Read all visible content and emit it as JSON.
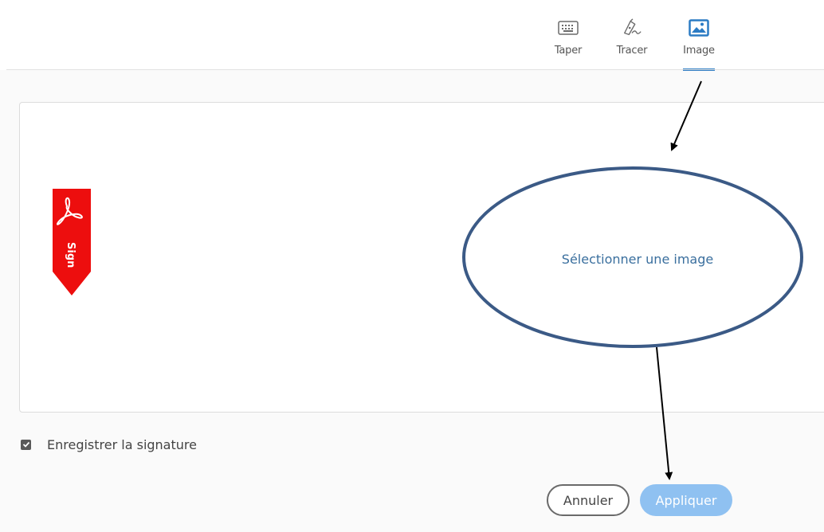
{
  "tabs": [
    {
      "label": "Taper",
      "icon": "keyboard-icon"
    },
    {
      "label": "Tracer",
      "icon": "pen-draw-icon"
    },
    {
      "label": "Image",
      "icon": "image-icon",
      "active": true
    }
  ],
  "signature_area": {
    "placeholder_logo_text": "Sign",
    "select_image_label": "Sélectionner une image"
  },
  "save_signature": {
    "label": "Enregistrer la signature",
    "checked": true
  },
  "buttons": {
    "cancel": "Annuler",
    "apply": "Appliquer"
  },
  "colors": {
    "accent": "#2b7bc4",
    "apply_button": "#8fc1f1",
    "ribbon_red": "#ed0e0e",
    "annotation_ellipse": "#3b5a86"
  }
}
